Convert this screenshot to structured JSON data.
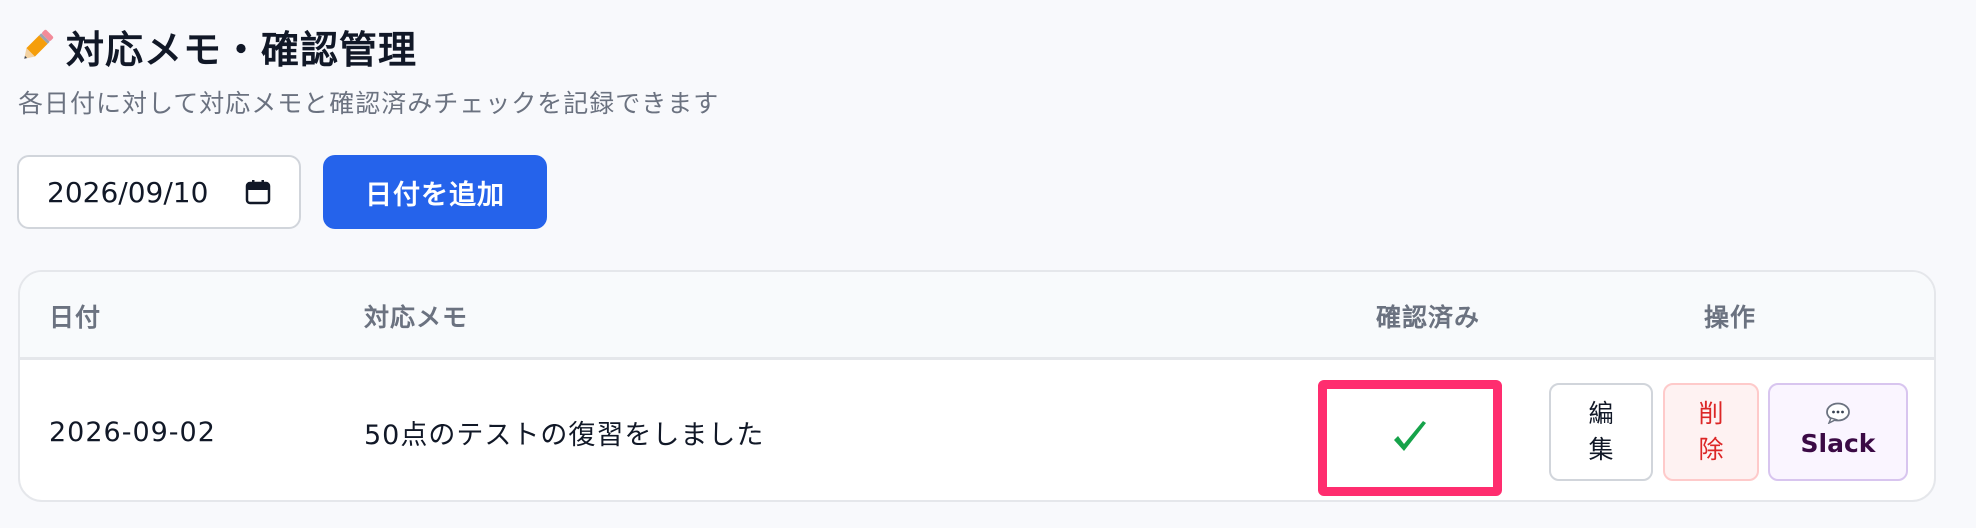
{
  "header": {
    "title": "対応メモ・確認管理",
    "subtitle": "各日付に対して対応メモと確認済みチェックを記録できます",
    "title_icon": "pencil-icon"
  },
  "date_picker": {
    "value": "2026/09/10",
    "icon": "calendar-icon"
  },
  "add_button": {
    "label": "日付を追加",
    "color": "#2563eb"
  },
  "table": {
    "columns": [
      "日付",
      "対応メモ",
      "確認済み",
      "操作"
    ],
    "rows": [
      {
        "date": "2026-09-02",
        "memo": "50点のテストの復習をしました",
        "confirmed": true,
        "confirmed_icon": "check-icon",
        "actions": {
          "edit": [
            "編",
            "集"
          ],
          "delete": [
            "削",
            "除"
          ],
          "slack": "Slack",
          "slack_icon": "speech-bubble-icon"
        }
      }
    ]
  },
  "colors": {
    "highlight_border": "#ff2d6f",
    "check": "#16a34a",
    "delete_text": "#dc2626",
    "slack_text": "#3b0a45"
  }
}
